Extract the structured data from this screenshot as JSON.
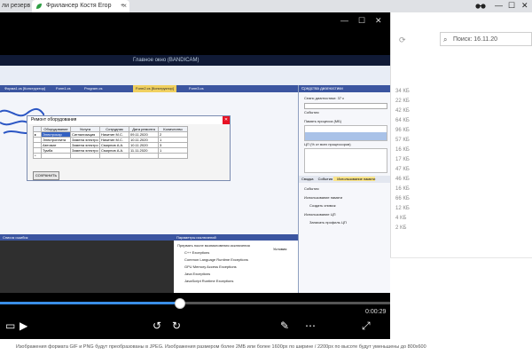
{
  "browser": {
    "tabs": [
      {
        "label": "ли резерв"
      },
      {
        "label": "Фрилансер Костя Егор"
      }
    ],
    "new_tab": "+",
    "controls": {
      "minimize": "—",
      "maximize": "☐",
      "close": "✕"
    }
  },
  "explorer": {
    "search_placeholder": "Поиск: 16.11.20",
    "sizes": [
      "34 КБ",
      "22 КБ",
      "42 КБ",
      "64 КБ",
      "96 КБ",
      "57 КБ",
      "16 КБ",
      "17 КБ",
      "47 КБ",
      "46 КБ",
      "16 КБ",
      "66 КБ",
      "12 КБ",
      "4 КБ",
      "2 КБ"
    ]
  },
  "player": {
    "controls": {
      "minimize": "—",
      "maximize": "☐",
      "close": "✕"
    },
    "timecode": "0:00:29",
    "progress": 0.46,
    "ide": {
      "title": "Главное окно (BANDICAM)",
      "tabs": [
        "Форма1.cs [Конструктор]",
        "Form1.cs",
        "Program.cs",
        "Form2.cs [Конструктор]",
        "Form3.cs"
      ],
      "dialog": {
        "title": "Ремонт оборудования",
        "headers": [
          "",
          "Оборудование",
          "Услуга",
          "Сотрудник",
          "Дата ремонта",
          "Количество"
        ],
        "rows": [
          [
            "▸",
            "Электрокар",
            "Сигнализация",
            "Никитин М.С.",
            "09.11.2020",
            "2"
          ],
          [
            "",
            "Электроплита",
            "Замена электро",
            "Никитин М.С.",
            "10.11.2020",
            "1"
          ],
          [
            "",
            "Автомат",
            "Замена электро",
            "Смирнов А.А.",
            "10.11.2020",
            "3"
          ],
          [
            "",
            "Тумба",
            "Замена электро",
            "Смирнов А.А.",
            "11.11.2020",
            "1"
          ],
          [
            "*",
            "",
            "",
            "",
            "",
            ""
          ]
        ],
        "save_button": "СОХРАНИТЬ"
      },
      "side": {
        "title": "Средства диагностики",
        "lines": [
          "Сеанс диагностики: 37 с",
          "События",
          "Память процесса (МБ)",
          "ЦП (% от всех процессоров)",
          "Сводка",
          "События",
          "Использование памяти",
          "Создать снимок",
          "Использование ЦП",
          "Записать профиль ЦП"
        ],
        "bottom_tabs": [
          "Сводка",
          "События",
          "Использование памяти"
        ]
      },
      "bottom": {
        "left_title": "Список ошибок",
        "right_title": "Параметры исключений",
        "tree": [
          "Прервать после возникновения исключения",
          "C++ Exceptions",
          "Common Language Runtime Exceptions",
          "GPU Memory Access Exceptions",
          "Java Exceptions",
          "JavaScript Runtime Exceptions"
        ],
        "condition": "Условия"
      }
    },
    "buttons": [
      {
        "name": "subtitles-icon",
        "glyph": "▭"
      },
      {
        "name": "play-icon",
        "glyph": "▶"
      },
      {
        "name": "rewind-icon",
        "glyph": "↺"
      },
      {
        "name": "forward-icon",
        "glyph": "↻"
      },
      {
        "name": "edit-icon",
        "glyph": "✎"
      },
      {
        "name": "more-icon",
        "glyph": "⋯"
      },
      {
        "name": "fullscreen-icon",
        "glyph": "⤢"
      }
    ]
  },
  "page_note": "Изображения формата GIF и PNG будут преобразованы в JPEG. Изображения размером более 2МБ или более 1600px по ширине / 2200px по высоте будут уменьшены до 800x600"
}
